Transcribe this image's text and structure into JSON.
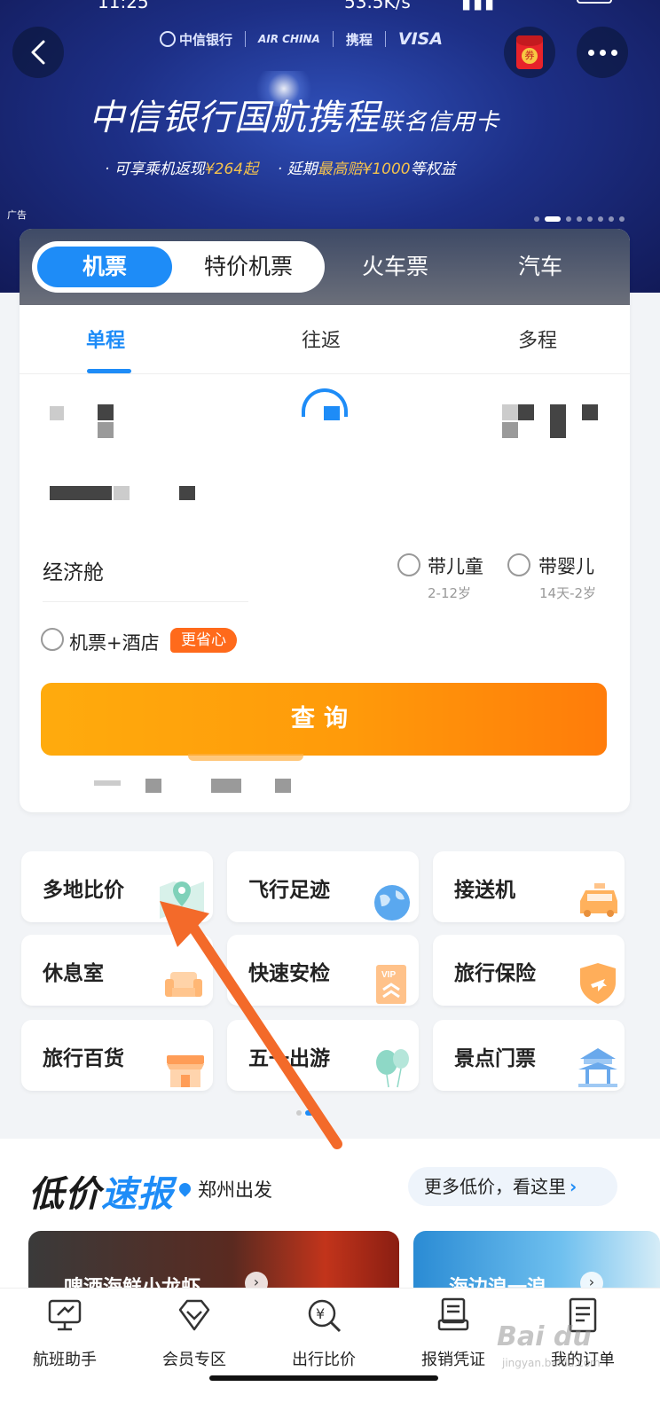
{
  "status_bar": {
    "time": "11:25",
    "network_speed": "53.5K/s"
  },
  "banner": {
    "brands": [
      "中信银行",
      "AIR CHINA",
      "携程",
      "VISA"
    ],
    "title": "中信银行国航携程",
    "title_suffix": "联名信用卡",
    "sub1_prefix": "· 可享乘机返现",
    "sub1_value": "¥264起",
    "sub2_prefix": "· 延期",
    "sub2_value": "最高赔¥1000",
    "sub2_suffix": "等权益",
    "ad_label": "广告",
    "coupon_label": "券",
    "page_count": 8,
    "page_index": 2
  },
  "top_tabs": {
    "flight": "机票",
    "special": "特价机票",
    "train": "火车票",
    "bus": "汽车"
  },
  "trip_tabs": {
    "oneway": "单程",
    "roundtrip": "往返",
    "multi": "多程"
  },
  "cabin": "经济舱",
  "options": {
    "child": "带儿童",
    "child_age": "2-12岁",
    "infant": "带婴儿",
    "infant_age": "14天-2岁",
    "hotel": "机票+酒店",
    "hotel_badge": "更省心"
  },
  "search_button": "查询",
  "services": [
    {
      "label": "多地比价",
      "icon": "map-pin-icon"
    },
    {
      "label": "飞行足迹",
      "icon": "globe-icon"
    },
    {
      "label": "接送机",
      "icon": "taxi-icon"
    },
    {
      "label": "休息室",
      "icon": "sofa-icon"
    },
    {
      "label": "快速安检",
      "icon": "vip-security-icon"
    },
    {
      "label": "旅行保险",
      "icon": "insurance-shield-icon"
    },
    {
      "label": "旅行百货",
      "icon": "shop-icon"
    },
    {
      "label": "五一出游",
      "icon": "balloon-icon"
    },
    {
      "label": "景点门票",
      "icon": "pavilion-icon"
    }
  ],
  "deals": {
    "title_a": "低价",
    "title_b": "速报",
    "location": "郑州出发",
    "more": "更多低价，看这里",
    "cards": [
      "啤酒海鲜小龙虾",
      "海边浪一浪"
    ]
  },
  "bottom_nav": [
    {
      "label": "航班助手",
      "icon": "flight-monitor-icon"
    },
    {
      "label": "会员专区",
      "icon": "member-diamond-icon"
    },
    {
      "label": "出行比价",
      "icon": "price-compare-icon"
    },
    {
      "label": "报销凭证",
      "icon": "receipt-icon"
    },
    {
      "label": "我的订单",
      "icon": "order-list-icon"
    }
  ],
  "colors": {
    "primary": "#1e8cf7",
    "accent_orange": "#ff9a0a",
    "badge_orange": "#ff6a1b",
    "banner_blue": "#1d2f86"
  }
}
